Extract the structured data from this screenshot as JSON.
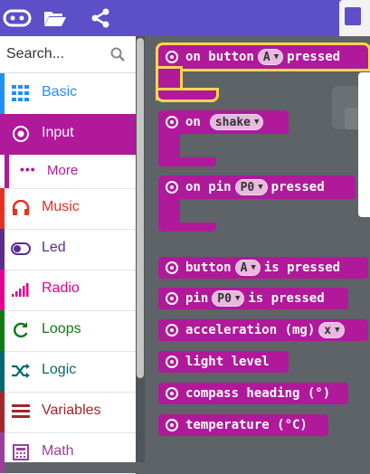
{
  "topbar": {
    "icons": [
      "microbit-icon",
      "folder-open-icon",
      "share-icon"
    ]
  },
  "search": {
    "placeholder": "Search..."
  },
  "categories": [
    {
      "label": "Basic",
      "icon": "grid-icon",
      "color": "#1e90ff",
      "selected": false
    },
    {
      "label": "Input",
      "icon": "radio-button-icon",
      "color": "#b0199a",
      "selected": true
    },
    {
      "label": "Music",
      "icon": "headphones-icon",
      "color": "#e63022",
      "selected": false
    },
    {
      "label": "Led",
      "icon": "toggle-icon",
      "color": "#5c2d91",
      "selected": false
    },
    {
      "label": "Radio",
      "icon": "signal-bars-icon",
      "color": "#e3008c",
      "selected": false
    },
    {
      "label": "Loops",
      "icon": "refresh-icon",
      "color": "#107c10",
      "selected": false
    },
    {
      "label": "Logic",
      "icon": "shuffle-icon",
      "color": "#006970",
      "selected": false
    },
    {
      "label": "Variables",
      "icon": "list-icon",
      "color": "#a4262c",
      "selected": false
    },
    {
      "label": "Math",
      "icon": "calculator-icon",
      "color": "#9c3f9c",
      "selected": false
    }
  ],
  "more": {
    "label": "More",
    "dots": "•••"
  },
  "blocks": {
    "on_button": {
      "prefix": "on button",
      "option": "A",
      "suffix": "pressed"
    },
    "on_shake": {
      "prefix": "on",
      "option": "shake"
    },
    "on_pin": {
      "prefix": "on pin",
      "option": "P0",
      "suffix": "pressed"
    },
    "button_pressed": {
      "prefix": "button",
      "option": "A",
      "suffix": "is pressed"
    },
    "pin_pressed": {
      "prefix": "pin",
      "option": "P0",
      "suffix": "is pressed"
    },
    "acceleration": {
      "prefix": "acceleration (mg)",
      "option": "x"
    },
    "light_level": {
      "label": "light level"
    },
    "compass_heading": {
      "label": "compass heading (°)"
    },
    "temperature": {
      "label": "temperature (°C)"
    }
  },
  "colors": {
    "input": "#b0199a",
    "topbar": "#5c4fc7",
    "workspace": "#5d6367",
    "highlight": "#ffd84d"
  }
}
